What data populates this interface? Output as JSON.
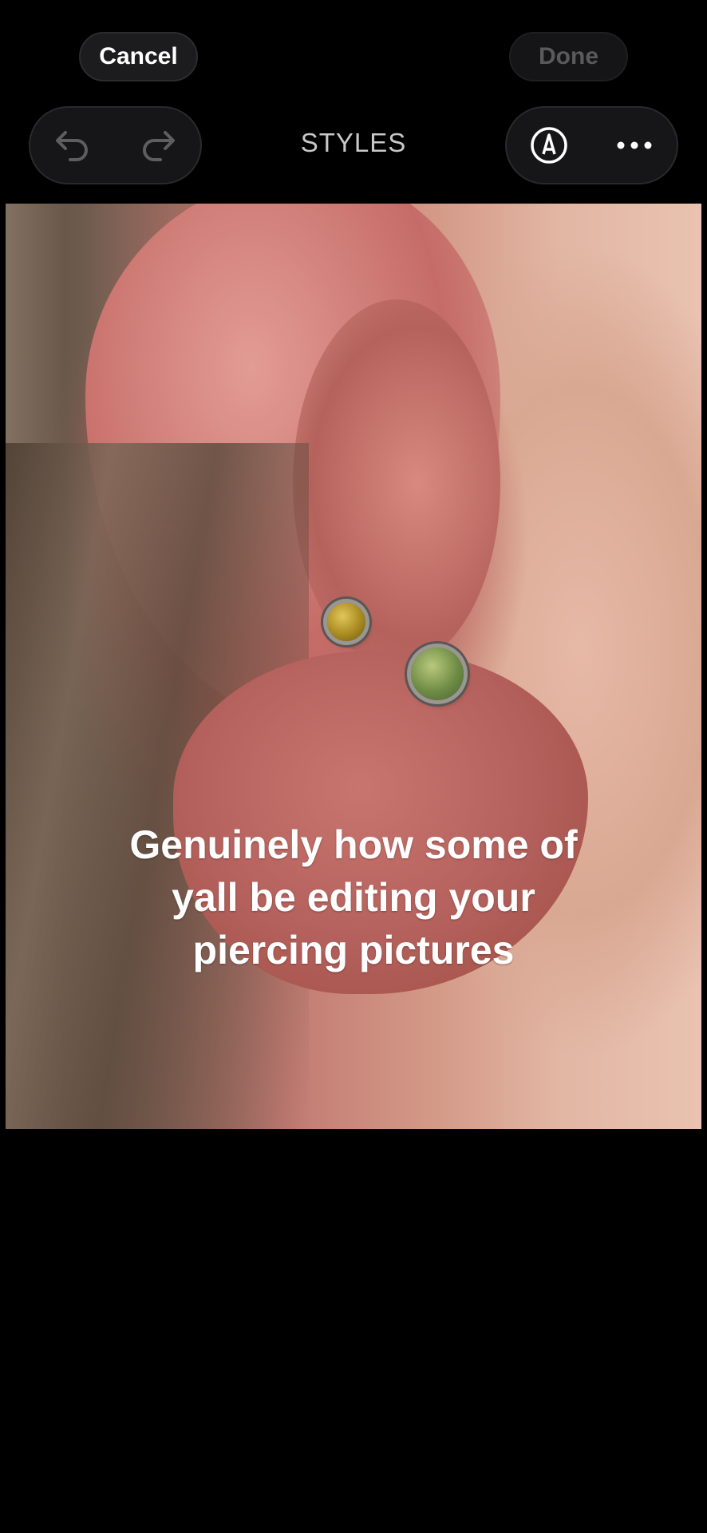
{
  "header": {
    "cancel_label": "Cancel",
    "done_label": "Done",
    "title": "STYLES"
  },
  "toolbar": {
    "left_icons": [
      "undo-icon",
      "redo-icon"
    ],
    "right_icons": [
      "markup-pen-icon",
      "more-icon"
    ]
  },
  "photo": {
    "caption_lines": [
      "Genuinely how some of",
      "yall be editing your",
      "piercing pictures"
    ]
  },
  "colors": {
    "background": "#000000",
    "button_bg": "#1c1c1e",
    "done_disabled_text": "#5a5a5c"
  }
}
